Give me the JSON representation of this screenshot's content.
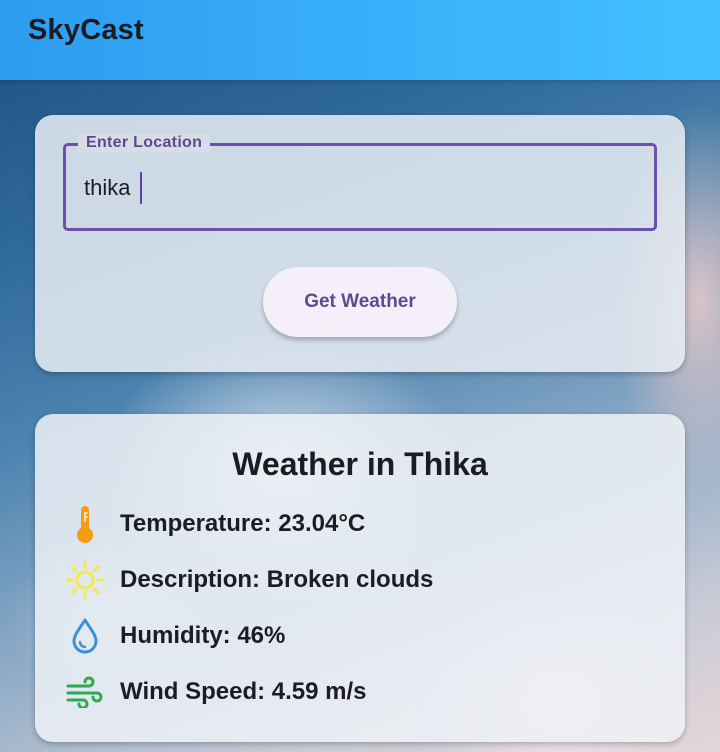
{
  "app": {
    "title": "SkyCast"
  },
  "search": {
    "label": "Enter Location",
    "value": "thika",
    "button_label": "Get Weather"
  },
  "weather": {
    "heading": "Weather in Thika",
    "rows": [
      {
        "icon": "thermometer-icon",
        "text": "Temperature: 23.04°C",
        "color": "#f39c12"
      },
      {
        "icon": "sun-icon",
        "text": "Description: Broken clouds",
        "color": "#f7e84e"
      },
      {
        "icon": "water-drop-icon",
        "text": "Humidity: 46%",
        "color": "#3b8fd9"
      },
      {
        "icon": "wind-icon",
        "text": "Wind Speed: 4.59 m/s",
        "color": "#2fa84f"
      }
    ]
  },
  "colors": {
    "appbar_start": "#2c9cf0",
    "appbar_end": "#42c0ff",
    "accent": "#6b51a8"
  }
}
